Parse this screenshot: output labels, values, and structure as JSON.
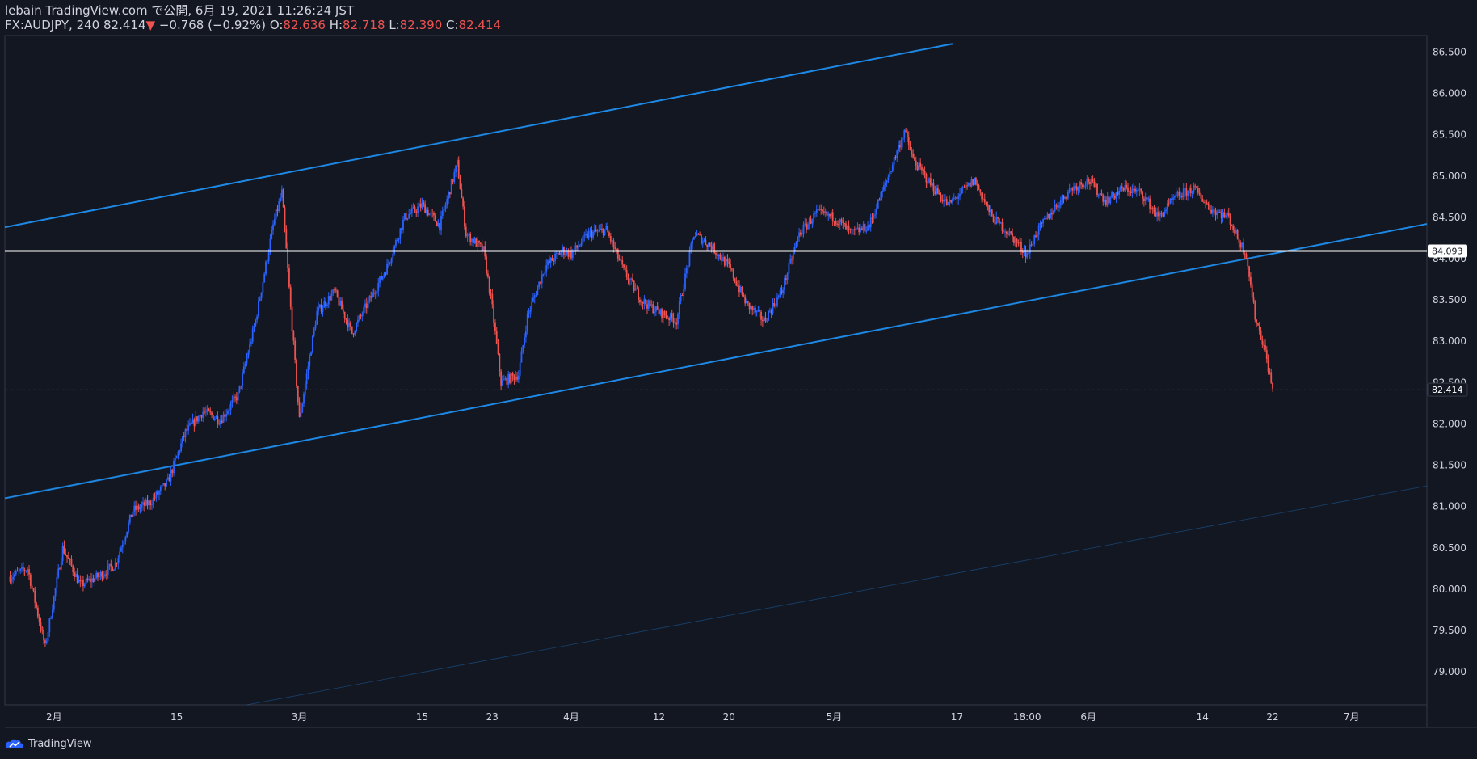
{
  "header": {
    "publisher": "lebain TradingView.com で公開, 6月 19, 2021 11:26:24 JST",
    "symbol": "FX:AUDJPY, 240",
    "last": "82.414",
    "change_arrow": "▼",
    "change": "−0.768 (−0.92%)",
    "o_label": "O:",
    "o_value": "82.636",
    "h_label": "H:",
    "h_value": "82.718",
    "l_label": "L:",
    "l_value": "82.390",
    "c_label": "C:",
    "c_value": "82.414"
  },
  "footer": {
    "brand": "TradingView",
    "logo_icon": "tradingview-cloud-icon"
  },
  "colors": {
    "background": "#131722",
    "up": "#2962ff",
    "down": "#ef5350",
    "trendline": "#1e88e5",
    "horizontal_line": "#ffffff",
    "axis_text": "#d1d4dc",
    "border": "#363a45"
  },
  "chart_data": {
    "type": "candlestick",
    "symbol": "FX:AUDJPY",
    "interval": "240",
    "ylim": [
      78.6,
      86.7
    ],
    "y_ticks": [
      "86.500",
      "86.000",
      "85.500",
      "85.000",
      "84.500",
      "84.000",
      "83.500",
      "83.000",
      "82.500",
      "82.000",
      "81.500",
      "81.000",
      "80.500",
      "80.000",
      "79.500",
      "79.000"
    ],
    "x_ticks": [
      {
        "label": "2月",
        "day": 5
      },
      {
        "label": "15",
        "day": 19
      },
      {
        "label": "3月",
        "day": 33
      },
      {
        "label": "15",
        "day": 47
      },
      {
        "label": "23",
        "day": 55
      },
      {
        "label": "4月",
        "day": 64
      },
      {
        "label": "12",
        "day": 74
      },
      {
        "label": "20",
        "day": 82
      },
      {
        "label": "5月",
        "day": 94
      },
      {
        "label": "17",
        "day": 108
      },
      {
        "label": "18:00",
        "day": 116
      },
      {
        "label": "6月",
        "day": 123
      },
      {
        "label": "14",
        "day": 136
      },
      {
        "label": "22",
        "day": 144
      },
      {
        "label": "7月",
        "day": 153
      }
    ],
    "xlim_days": [
      -0.6,
      161.6
    ],
    "horizontal_line": {
      "price": 84.093,
      "label": "84.093"
    },
    "last_price": {
      "price": 82.414,
      "label": "82.414"
    },
    "trendlines": [
      {
        "name": "channel-top",
        "points": [
          [
            -0.6,
            84.38
          ],
          [
            107.5,
            86.6
          ]
        ]
      },
      {
        "name": "channel-bottom",
        "points": [
          [
            -0.6,
            81.1
          ],
          [
            161.6,
            84.42
          ]
        ]
      },
      {
        "name": "parallel-lower",
        "points": [
          [
            27,
            78.6
          ],
          [
            161.6,
            81.25
          ]
        ]
      }
    ],
    "price_path": [
      [
        0,
        80.15
      ],
      [
        2,
        80.25
      ],
      [
        4,
        79.3
      ],
      [
        6,
        80.5
      ],
      [
        8,
        80.05
      ],
      [
        10,
        80.15
      ],
      [
        12,
        80.3
      ],
      [
        14,
        80.95
      ],
      [
        16,
        81.05
      ],
      [
        18,
        81.3
      ],
      [
        19,
        81.6
      ],
      [
        20,
        81.9
      ],
      [
        22,
        82.15
      ],
      [
        24,
        82.05
      ],
      [
        26,
        82.35
      ],
      [
        28,
        83.25
      ],
      [
        30,
        84.4
      ],
      [
        31,
        84.8
      ],
      [
        32,
        83.4
      ],
      [
        33,
        82.05
      ],
      [
        35,
        83.35
      ],
      [
        37,
        83.6
      ],
      [
        39,
        83.1
      ],
      [
        41,
        83.5
      ],
      [
        43,
        83.9
      ],
      [
        45,
        84.5
      ],
      [
        47,
        84.65
      ],
      [
        49,
        84.4
      ],
      [
        51,
        85.15
      ],
      [
        52,
        84.3
      ],
      [
        54,
        84.1
      ],
      [
        55,
        83.4
      ],
      [
        56,
        82.5
      ],
      [
        58,
        82.6
      ],
      [
        59,
        83.3
      ],
      [
        61,
        83.9
      ],
      [
        63,
        84.1
      ],
      [
        64,
        84.05
      ],
      [
        66,
        84.3
      ],
      [
        68,
        84.35
      ],
      [
        70,
        83.85
      ],
      [
        72,
        83.5
      ],
      [
        74,
        83.35
      ],
      [
        76,
        83.25
      ],
      [
        78,
        84.3
      ],
      [
        80,
        84.15
      ],
      [
        82,
        83.9
      ],
      [
        84,
        83.45
      ],
      [
        86,
        83.25
      ],
      [
        88,
        83.6
      ],
      [
        90,
        84.3
      ],
      [
        92,
        84.55
      ],
      [
        94,
        84.5
      ],
      [
        96,
        84.3
      ],
      [
        98,
        84.4
      ],
      [
        100,
        84.95
      ],
      [
        102,
        85.55
      ],
      [
        103,
        85.2
      ],
      [
        105,
        84.9
      ],
      [
        107,
        84.65
      ],
      [
        109,
        84.85
      ],
      [
        110,
        84.95
      ],
      [
        112,
        84.5
      ],
      [
        114,
        84.3
      ],
      [
        116,
        84.05
      ],
      [
        117,
        84.3
      ],
      [
        119,
        84.6
      ],
      [
        121,
        84.85
      ],
      [
        123,
        84.95
      ],
      [
        125,
        84.7
      ],
      [
        127,
        84.85
      ],
      [
        129,
        84.8
      ],
      [
        131,
        84.5
      ],
      [
        133,
        84.75
      ],
      [
        135,
        84.85
      ],
      [
        137,
        84.6
      ],
      [
        139,
        84.5
      ],
      [
        140,
        84.25
      ],
      [
        141,
        84.05
      ],
      [
        142,
        83.3
      ],
      [
        143,
        82.95
      ],
      [
        144,
        82.414
      ]
    ]
  }
}
